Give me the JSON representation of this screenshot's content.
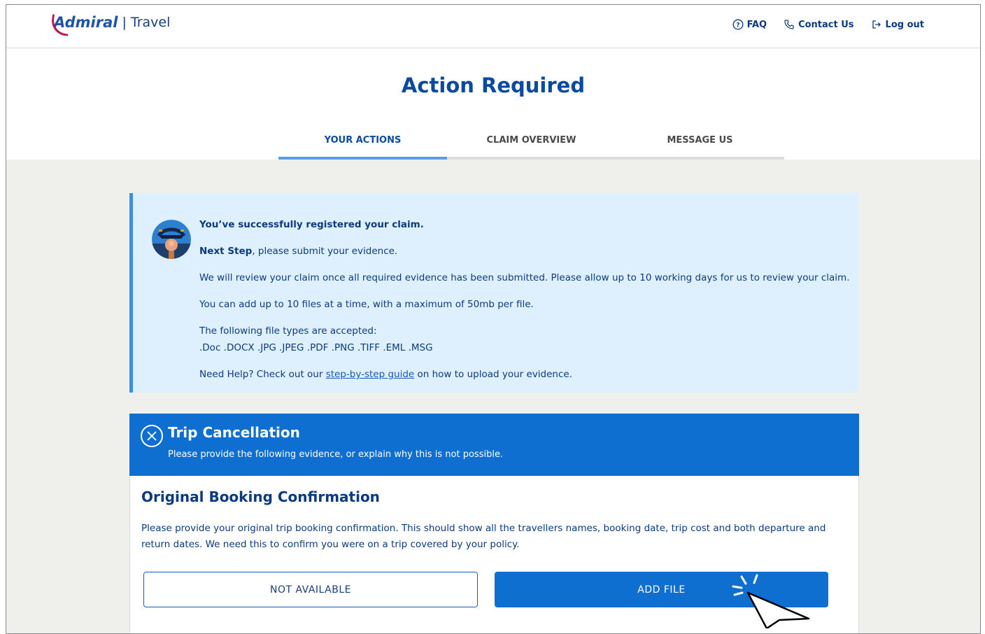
{
  "header": {
    "logo_text": "Admiral",
    "logo_sub": "| Travel",
    "nav": [
      {
        "label": "FAQ",
        "icon": "question-circle-icon"
      },
      {
        "label": "Contact Us",
        "icon": "phone-icon"
      },
      {
        "label": "Log out",
        "icon": "logout-icon"
      }
    ]
  },
  "page_title": "Action Required",
  "tabs": [
    {
      "label": "YOUR ACTIONS",
      "active": true
    },
    {
      "label": "CLAIM OVERVIEW",
      "active": false
    },
    {
      "label": "MESSAGE US",
      "active": false
    }
  ],
  "info": {
    "heading": "You’ve successfully registered your claim.",
    "next_step_bold": "Next Step",
    "next_step_rest": ", please submit your evidence.",
    "review": "We will review your claim once all required evidence has been submitted. Please allow up to 10 working days for us to review your claim.",
    "files": "You can add up to 10 files at a time, with a maximum of 50mb per file.",
    "types_intro": "The following file types are accepted:",
    "types_list": ".Doc .DOCX .JPG .JPEG .PDF .PNG .TIFF .EML .MSG",
    "help_prefix": "Need Help? Check out our ",
    "help_link": "step-by-step guide",
    "help_suffix": " on how to upload your evidence."
  },
  "claim": {
    "title": "Trip Cancellation",
    "subtitle": "Please provide the following evidence, or explain why this is not possible."
  },
  "evidence": {
    "title": "Original Booking Confirmation",
    "description": "Please provide your original trip booking confirmation. This should show all the travellers names, booking date, trip cost and both departure and return dates. We need this to confirm you were on a trip covered by your policy.",
    "not_available_label": "NOT AVAILABLE",
    "add_file_label": "ADD FILE"
  },
  "colors": {
    "brand_blue": "#0e6fd0",
    "text_navy": "#0b3a7e",
    "info_bg": "#def0fd",
    "logo_accent": "#c0134f"
  }
}
